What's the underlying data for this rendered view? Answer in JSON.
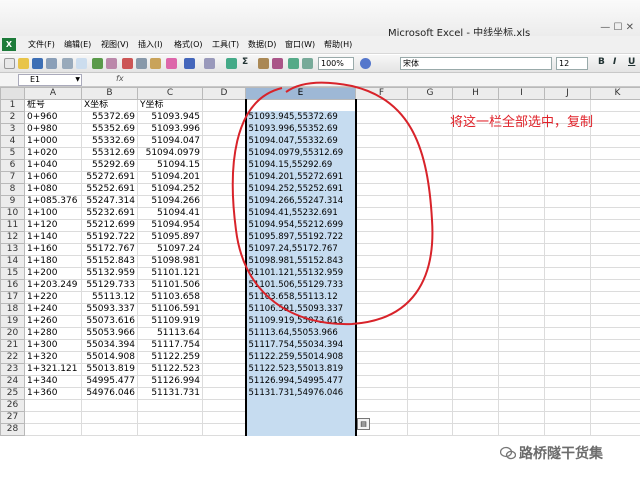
{
  "window": {
    "title": "Microsoft Excel - 中线坐标.xls",
    "controls": "— ☐ ✕"
  },
  "menu": [
    "文件(F)",
    "编辑(E)",
    "视图(V)",
    "插入(I)",
    "格式(O)",
    "工具(T)",
    "数据(D)",
    "窗口(W)",
    "帮助(H)"
  ],
  "toolbar": {
    "zoom": "100%",
    "font": "宋体",
    "font_size": "12",
    "bold": "B",
    "italic": "I",
    "underline": "U",
    "sum": "Σ"
  },
  "formula_bar": {
    "name_box": "E1",
    "fx": "fx",
    "content": ""
  },
  "columns": [
    "A",
    "B",
    "C",
    "D",
    "E",
    "F",
    "G",
    "H",
    "I",
    "J",
    "K"
  ],
  "rows": [
    [
      "桩号",
      "X坐标",
      "Y坐标",
      "",
      ""
    ],
    [
      "0+960",
      "55372.69",
      "51093.945",
      "",
      "51093.945,55372.69"
    ],
    [
      "0+980",
      "55352.69",
      "51093.996",
      "",
      "51093.996,55352.69"
    ],
    [
      "1+000",
      "55332.69",
      "51094.047",
      "",
      "51094.047,55332.69"
    ],
    [
      "1+020",
      "55312.69",
      "51094.0979",
      "",
      "51094.0979,55312.69"
    ],
    [
      "1+040",
      "55292.69",
      "51094.15",
      "",
      "51094.15,55292.69"
    ],
    [
      "1+060",
      "55272.691",
      "51094.201",
      "",
      "51094.201,55272.691"
    ],
    [
      "1+080",
      "55252.691",
      "51094.252",
      "",
      "51094.252,55252.691"
    ],
    [
      "1+085.376",
      "55247.314",
      "51094.266",
      "",
      "51094.266,55247.314"
    ],
    [
      "1+100",
      "55232.691",
      "51094.41",
      "",
      "51094.41,55232.691"
    ],
    [
      "1+120",
      "55212.699",
      "51094.954",
      "",
      "51094.954,55212.699"
    ],
    [
      "1+140",
      "55192.722",
      "51095.897",
      "",
      "51095.897,55192.722"
    ],
    [
      "1+160",
      "55172.767",
      "51097.24",
      "",
      "51097.24,55172.767"
    ],
    [
      "1+180",
      "55152.843",
      "51098.981",
      "",
      "51098.981,55152.843"
    ],
    [
      "1+200",
      "55132.959",
      "51101.121",
      "",
      "51101.121,55132.959"
    ],
    [
      "1+203.249",
      "55129.733",
      "51101.506",
      "",
      "51101.506,55129.733"
    ],
    [
      "1+220",
      "55113.12",
      "51103.658",
      "",
      "51103.658,55113.12"
    ],
    [
      "1+240",
      "55093.337",
      "51106.591",
      "",
      "51106.591,55093.337"
    ],
    [
      "1+260",
      "55073.616",
      "51109.919",
      "",
      "51109.919,55073.616"
    ],
    [
      "1+280",
      "55053.966",
      "51113.64",
      "",
      "51113.64,55053.966"
    ],
    [
      "1+300",
      "55034.394",
      "51117.754",
      "",
      "51117.754,55034.394"
    ],
    [
      "1+320",
      "55014.908",
      "51122.259",
      "",
      "51122.259,55014.908"
    ],
    [
      "1+321.121",
      "55013.819",
      "51122.523",
      "",
      "51122.523,55013.819"
    ],
    [
      "1+340",
      "54995.477",
      "51126.994",
      "",
      "51126.994,54995.477"
    ],
    [
      "1+360",
      "54976.046",
      "51131.731",
      "",
      "51131.731,54976.046"
    ],
    [
      "",
      "",
      "",
      "",
      ""
    ],
    [
      "",
      "",
      "",
      "",
      ""
    ],
    [
      "",
      "",
      "",
      "",
      ""
    ]
  ],
  "annotation": "将这一栏全部选中，复制",
  "watermark": "路桥隧干货集",
  "colors": {
    "selection": "#c6dcf0",
    "annotation": "#e0222a",
    "excel_green": "#1d7b3a"
  }
}
